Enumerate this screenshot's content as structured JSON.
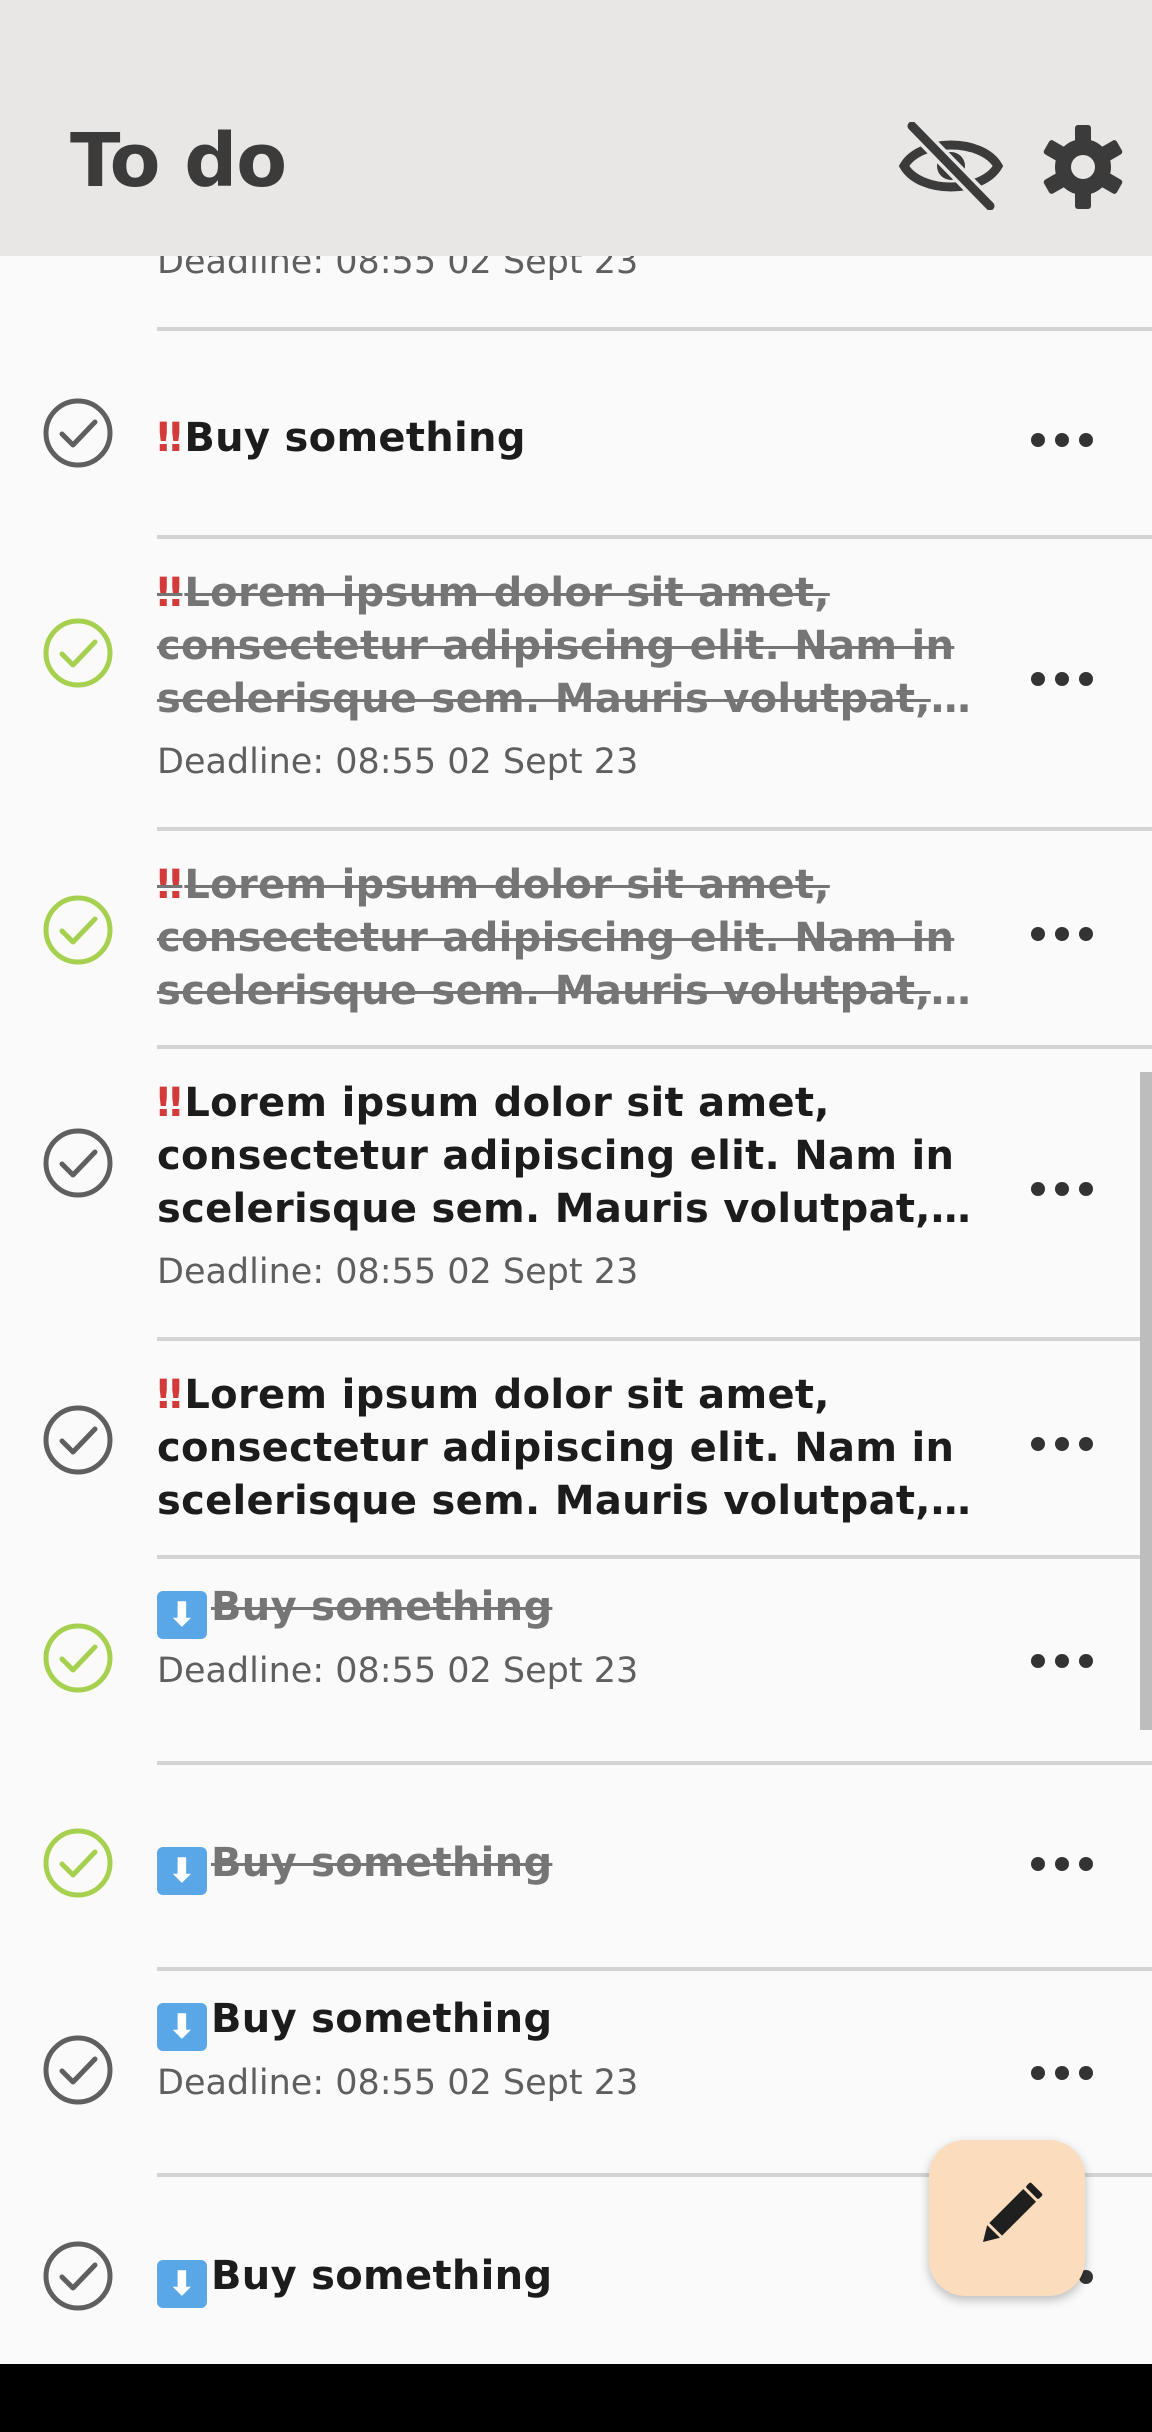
{
  "appbar": {
    "title": "To do",
    "hide_icon": "eye-off-icon",
    "settings_icon": "gear-icon"
  },
  "colors": {
    "done": "#a6d04f",
    "pending": "#5f5f5f",
    "priority_high": "#d33a3a",
    "priority_low": "#5aa7e8",
    "fab": "#fbdcbc"
  },
  "tasks": [
    {
      "deadline": "Deadline: 08:55 02 Sept 23"
    },
    {
      "prio": "‼",
      "title": "Buy something",
      "done": false
    },
    {
      "prio": "‼",
      "title": "Lorem ipsum dolor sit amet, consectetur adipiscing elit. Nam in scelerisque sem. Mauris volutpat, dolor sit amet",
      "deadline": "Deadline: 08:55 02 Sept 23",
      "done": true
    },
    {
      "prio": "‼",
      "title": "Lorem ipsum dolor sit amet, consectetur adipiscing elit. Nam in scelerisque sem. Mauris volutpat, dolor sit amet",
      "done": true
    },
    {
      "prio": "‼",
      "title": "Lorem ipsum dolor sit amet, consectetur adipiscing elit. Nam in scelerisque sem. Mauris volutpat, dolor sit amet",
      "deadline": "Deadline: 08:55 02 Sept 23",
      "done": false
    },
    {
      "prio": "‼",
      "title": "Lorem ipsum dolor sit amet, consectetur adipiscing elit. Nam in scelerisque sem. Mauris volutpat, dolor sit amet",
      "done": false
    },
    {
      "prio": "⬇",
      "title": "Buy something",
      "deadline": "Deadline: 08:55 02 Sept 23",
      "done": true
    },
    {
      "prio": "⬇",
      "title": "Buy something",
      "done": true
    },
    {
      "prio": "⬇",
      "title": "Buy something",
      "deadline": "Deadline: 08:55 02 Sept 23",
      "done": false
    },
    {
      "prio": "⬇",
      "title": "Buy something",
      "done": false
    }
  ],
  "fab": {
    "icon": "pencil-icon"
  }
}
